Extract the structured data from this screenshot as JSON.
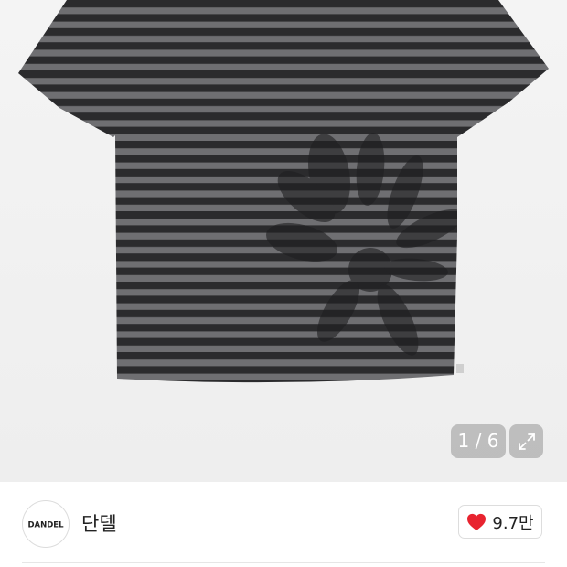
{
  "gallery": {
    "image_name": "striped-tshirt-with-flower-print",
    "counter": "1 / 6",
    "expand_icon": "expand-icon"
  },
  "brand": {
    "logo_text": "DANDEL",
    "name": "단델"
  },
  "like": {
    "icon": "heart-icon",
    "count": "9.7만",
    "color": "#e8232f"
  },
  "colors": {
    "stripe_dark": "#2c2c2e",
    "stripe_light": "#6f6f72"
  }
}
